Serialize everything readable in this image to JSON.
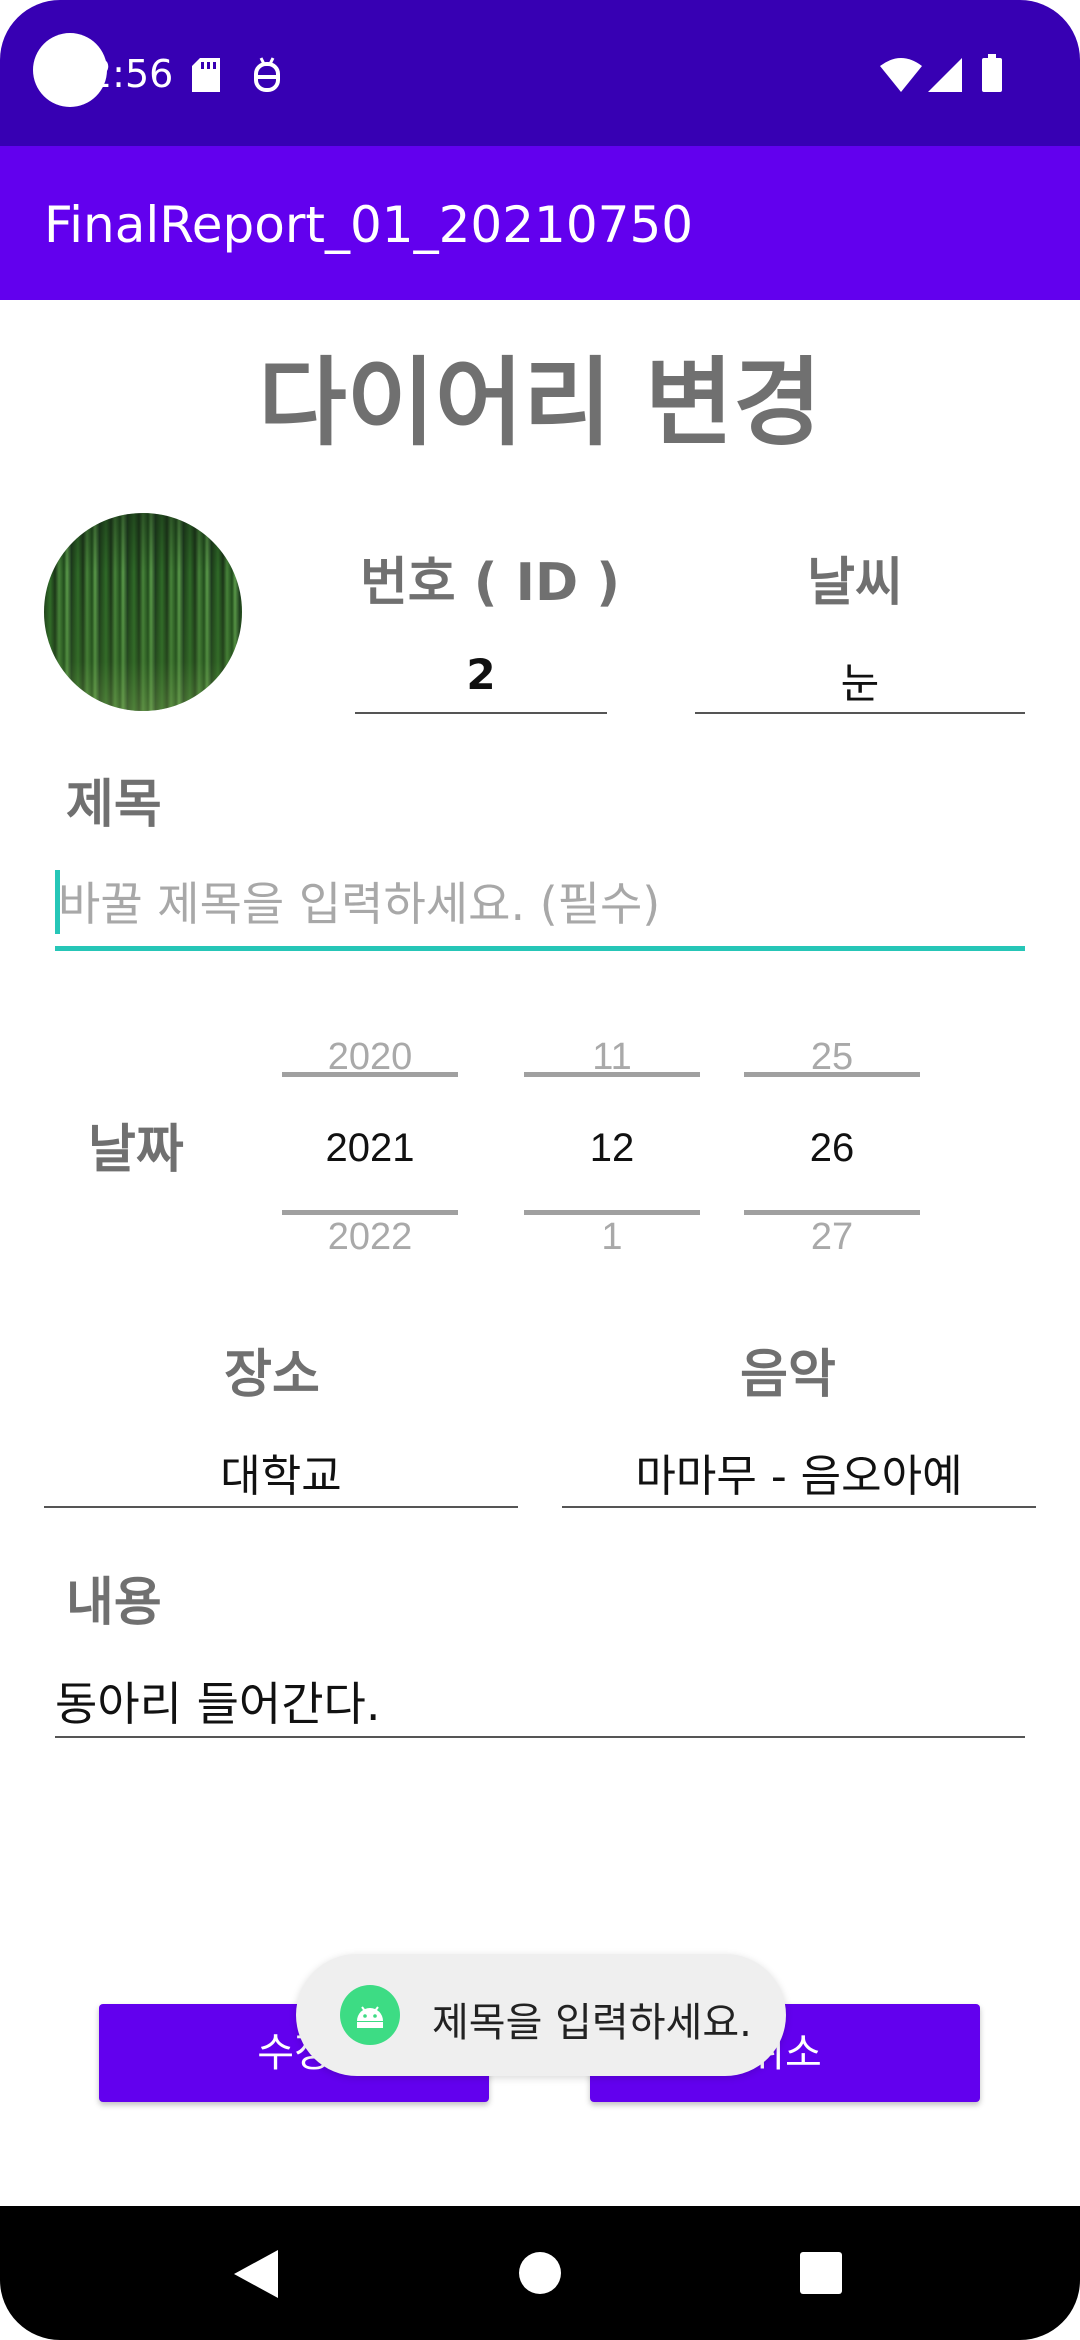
{
  "status_bar": {
    "time": "2:56"
  },
  "app_bar": {
    "title": "FinalReport_01_20210750"
  },
  "page": {
    "title": "다이어리 변경"
  },
  "id_field": {
    "label": "번호 ( ID )",
    "value": "2"
  },
  "weather_field": {
    "label": "날씨",
    "value": "눈"
  },
  "title_field": {
    "label": "제목",
    "placeholder": "바꿀 제목을 입력하세요. (필수)"
  },
  "date_field": {
    "label": "날짜",
    "year": {
      "prev": "2020",
      "selected": "2021",
      "next": "2022"
    },
    "month": {
      "prev": "11",
      "selected": "12",
      "next": "1"
    },
    "day": {
      "prev": "25",
      "selected": "26",
      "next": "27"
    }
  },
  "place_field": {
    "label": "장소",
    "value": "대학교"
  },
  "music_field": {
    "label": "음악",
    "value": "마마무 - 음오아예"
  },
  "content_field": {
    "label": "내용",
    "value": "동아리 들어간다."
  },
  "buttons": {
    "modify_label": "수정",
    "cancel_label": "취소"
  },
  "toast": {
    "message": "제목을 입력하세요."
  },
  "colors": {
    "status_bar": "#3700b3",
    "app_bar": "#6200ee",
    "accent": "#26c6b7",
    "button": "#6200ee"
  },
  "icons": [
    "sd-card-icon",
    "debug-icon",
    "wifi-icon",
    "signal-icon",
    "battery-icon",
    "android-icon",
    "back-icon",
    "home-icon",
    "recents-icon"
  ]
}
